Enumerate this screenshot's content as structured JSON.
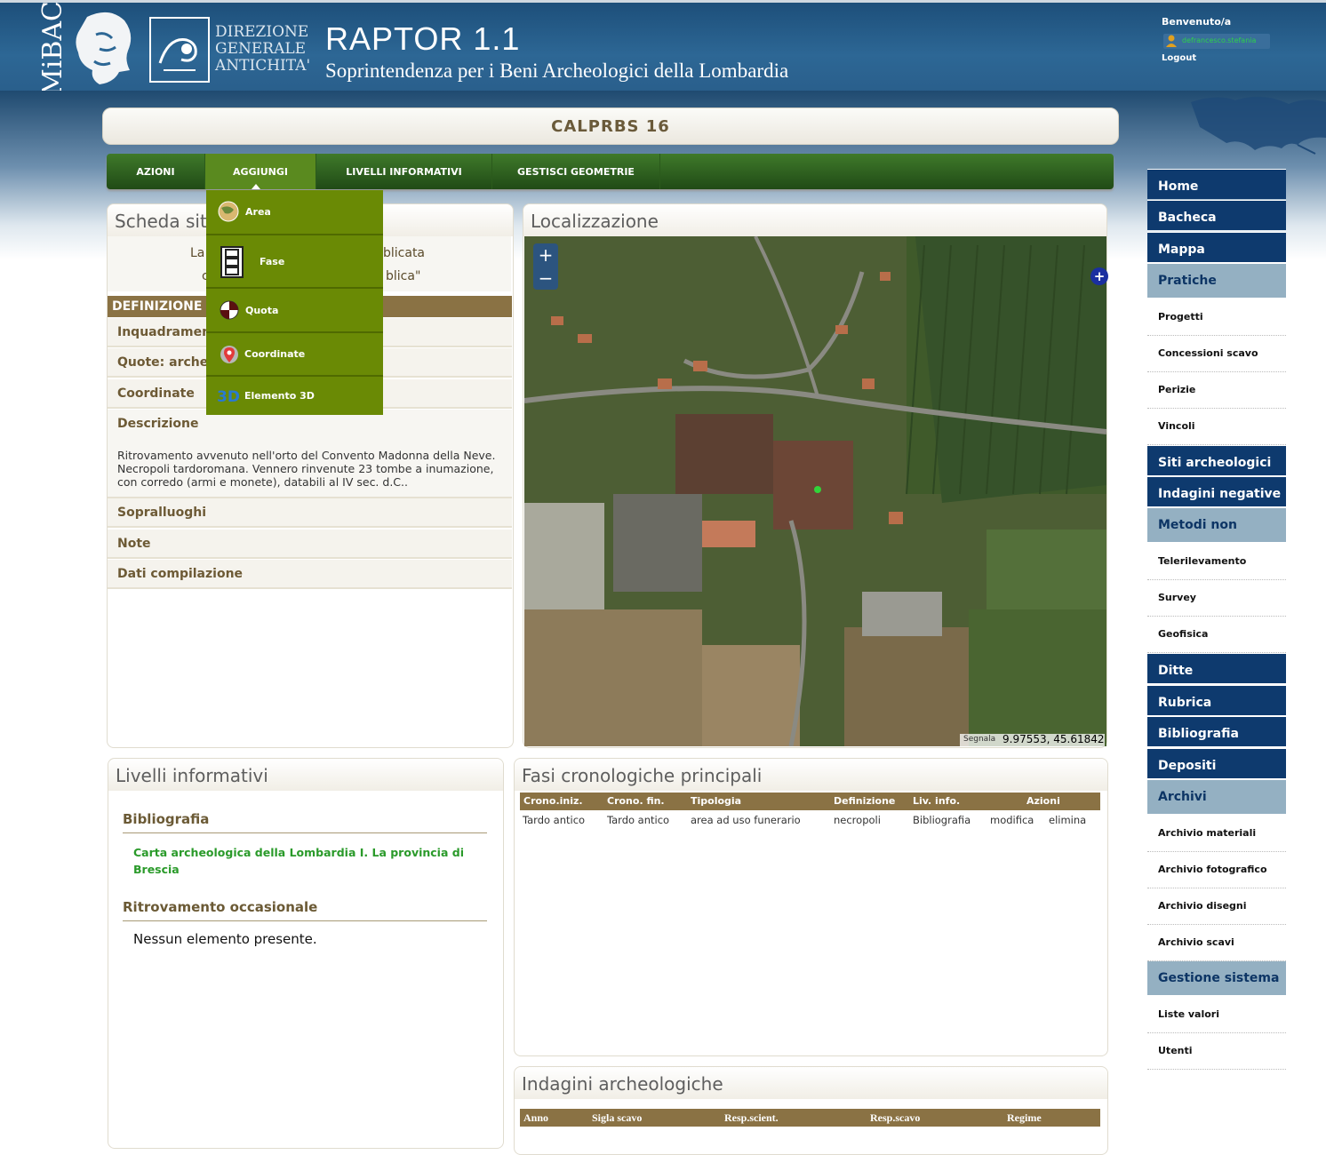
{
  "header": {
    "logo_text": "MiBAC",
    "dga_lines": [
      "DIREZIONE",
      "GENERALE",
      "ANTICHITA'"
    ],
    "app_title": "RAPTOR 1.1",
    "app_subtitle": "Soprintendenza per i Beni Archeologici della Lombardia",
    "welcome": "Benvenuto/a",
    "user": "defrancesco.stefania",
    "logout": "Logout"
  },
  "page_title": "CALPRBS 16",
  "nav": {
    "items": [
      "AZIONI",
      "AGGIUNGI",
      "LIVELLI INFORMATIVI",
      "GESTISCI GEOMETRIE"
    ],
    "active": "AGGIUNGI"
  },
  "aggiungi_menu": [
    {
      "label": "Area",
      "icon": "globe-icon"
    },
    {
      "label": "Fase",
      "icon": "phase-grid-icon"
    },
    {
      "label": "Quota",
      "icon": "level-marker-icon"
    },
    {
      "label": "Coordinate",
      "icon": "map-pin-icon"
    },
    {
      "label": "Elemento 3D",
      "icon": "3d-icon"
    }
  ],
  "scheda": {
    "title_visible": "Scheda sit",
    "info_line1_left": "La",
    "info_line1_right": "blicata",
    "info_line2_left": "c",
    "info_line2_right": "blica\"",
    "definizione_visible": "DEFINIZIONE",
    "rows": {
      "inquadramento": "Inquadrament",
      "quote": "Quote: arche",
      "coordinate": "Coordinate",
      "descrizione": "Descrizione",
      "sopralluoghi": "Sopralluoghi",
      "note": "Note",
      "dati": "Dati compilazione"
    },
    "description_text": "Ritrovamento avvenuto nell'orto del Convento Madonna della Neve. Necropoli tardoromana. Vennero rinvenute 23 tombe a inumazione, con corredo (armi e monete), databili al IV sec. d.C.."
  },
  "localizzazione": {
    "title": "Localizzazione",
    "zoom_in": "+",
    "zoom_out": "−",
    "layer_switch": "+",
    "coord_label": "Segnala",
    "coords": "9.97553, 45.61842"
  },
  "livelli": {
    "title": "Livelli informativi",
    "bibliografia_title": "Bibliografia",
    "bibliografia_link": "Carta archeologica della Lombardia I. La provincia di Brescia",
    "ritrovamento_title": "Ritrovamento occasionale",
    "empty_text": "Nessun elemento presente."
  },
  "fasi": {
    "title": "Fasi cronologiche principali",
    "columns": [
      "Crono.iniz.",
      "Crono. fin.",
      "Tipologia",
      "Definizione",
      "Liv. info.",
      "Azioni"
    ],
    "rows": [
      [
        "Tardo antico",
        "Tardo antico",
        "area ad uso funerario",
        "necropoli",
        "Bibliografia",
        "modifica",
        "elimina"
      ]
    ]
  },
  "indagini": {
    "title": "Indagini archeologiche",
    "columns": [
      "Anno",
      "Sigla scavo",
      "Resp.scient.",
      "Resp.scavo",
      "Regime"
    ]
  },
  "sidebar": {
    "items": [
      {
        "label": "Home",
        "style": "blue"
      },
      {
        "label": "Bacheca",
        "style": "blue"
      },
      {
        "label": "Mappa",
        "style": "blue"
      },
      {
        "label": "Pratiche",
        "style": "light"
      },
      {
        "label": "Progetti",
        "style": "sub"
      },
      {
        "label": "Concessioni scavo",
        "style": "sub"
      },
      {
        "label": "Perizie",
        "style": "sub"
      },
      {
        "label": "Vincoli",
        "style": "sub"
      },
      {
        "label": "Siti archeologici",
        "style": "blue"
      },
      {
        "label": "Indagini negative",
        "style": "blue"
      },
      {
        "label": "Metodi non invasivi",
        "style": "light"
      },
      {
        "label": "Telerilevamento",
        "style": "sub"
      },
      {
        "label": "Survey",
        "style": "sub"
      },
      {
        "label": "Geofisica",
        "style": "sub"
      },
      {
        "label": "Ditte",
        "style": "blue"
      },
      {
        "label": "Rubrica",
        "style": "blue"
      },
      {
        "label": "Bibliografia",
        "style": "blue"
      },
      {
        "label": "Depositi",
        "style": "blue"
      },
      {
        "label": "Archivi",
        "style": "light"
      },
      {
        "label": "Archivio materiali",
        "style": "sub"
      },
      {
        "label": "Archivio fotografico",
        "style": "sub"
      },
      {
        "label": "Archivio disegni",
        "style": "sub"
      },
      {
        "label": "Archivio scavi",
        "style": "sub"
      },
      {
        "label": "Gestione sistema",
        "style": "light"
      },
      {
        "label": "Liste valori",
        "style": "sub"
      },
      {
        "label": "Utenti",
        "style": "sub"
      }
    ]
  }
}
